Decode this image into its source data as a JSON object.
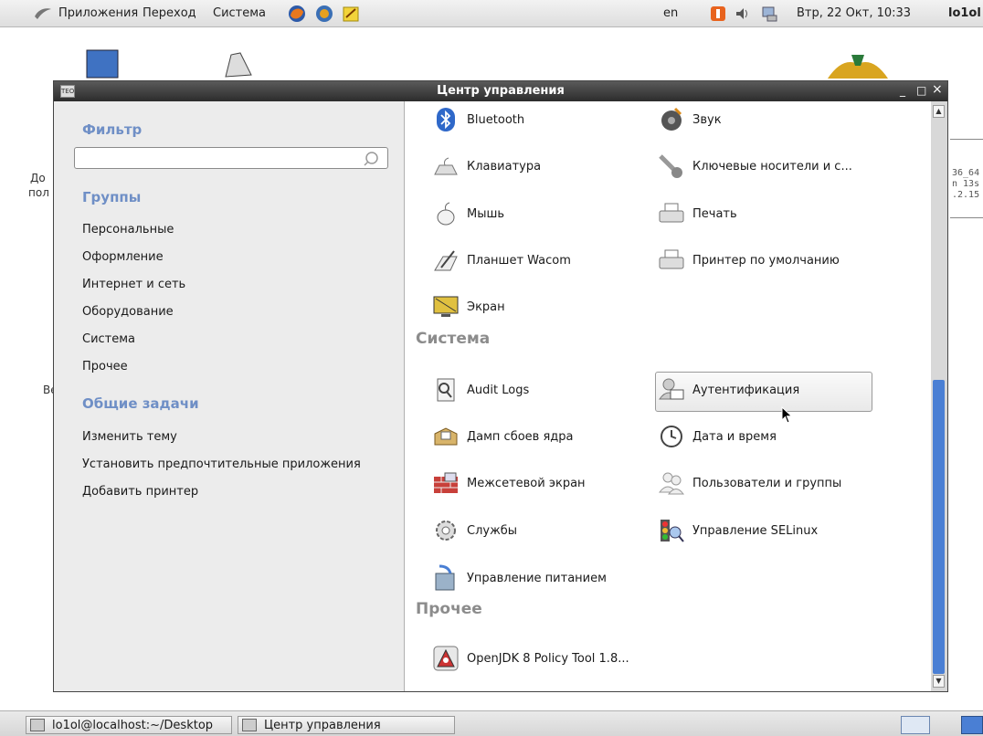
{
  "top_panel": {
    "menu": [
      "Приложения",
      "Переход",
      "Система"
    ],
    "keyboard_layout": "en",
    "clock": "Втр, 22 Окт, 10:33",
    "user": "lo1ol"
  },
  "desktop": {
    "left_fragments": [
      "До",
      "пол",
      "Ве"
    ],
    "right_fragments": [
      "36_64",
      "n 13s",
      ".2.15"
    ]
  },
  "window": {
    "title": "Центр управления",
    "minimize": "_",
    "maximize": "□",
    "close": "×",
    "app_icon_text": "TEO"
  },
  "sidebar": {
    "filter_heading": "Фильтр",
    "filter_value": "",
    "groups_heading": "Группы",
    "groups": [
      "Персональные",
      "Оформление",
      "Интернет и сеть",
      "Оборудование",
      "Система",
      "Прочее"
    ],
    "tasks_heading": "Общие задачи",
    "tasks": [
      "Изменить тему",
      "Установить предпочтительные приложения",
      "Добавить принтер"
    ]
  },
  "content": {
    "hardware_items": [
      {
        "label": "Bluetooth",
        "icon": "bluetooth-icon"
      },
      {
        "label": "Звук",
        "icon": "sound-icon"
      },
      {
        "label": "Клавиатура",
        "icon": "keyboard-icon"
      },
      {
        "label": "Ключевые носители и с...",
        "icon": "key-icon"
      },
      {
        "label": "Мышь",
        "icon": "mouse-icon"
      },
      {
        "label": "Печать",
        "icon": "printer-icon"
      },
      {
        "label": "Планшет Wacom",
        "icon": "tablet-icon"
      },
      {
        "label": "Принтер по умолчанию",
        "icon": "printer-icon"
      },
      {
        "label": "Экран",
        "icon": "display-icon"
      }
    ],
    "system_heading": "Система",
    "system_items": [
      {
        "label": "Audit Logs",
        "icon": "log-icon"
      },
      {
        "label": "Аутентификация",
        "icon": "authentication-icon"
      },
      {
        "label": "Дамп сбоев ядра",
        "icon": "crash-dump-icon"
      },
      {
        "label": "Дата и время",
        "icon": "clock-icon"
      },
      {
        "label": "Межсетевой экран",
        "icon": "firewall-icon"
      },
      {
        "label": "Пользователи и группы",
        "icon": "users-icon"
      },
      {
        "label": "Службы",
        "icon": "services-icon"
      },
      {
        "label": "Управление SELinux",
        "icon": "selinux-icon"
      },
      {
        "label": "Управление питанием",
        "icon": "power-icon"
      }
    ],
    "other_heading": "Прочее",
    "other_items": [
      {
        "label": "OpenJDK 8 Policy Tool 1.8...",
        "icon": "java-icon"
      }
    ],
    "selected_item": "Аутентификация"
  },
  "taskbar": {
    "tasks": [
      "lo1ol@localhost:~/Desktop",
      "Центр управления"
    ]
  },
  "colors": {
    "heading_blue": "#6f8fc6",
    "section_gray": "#8c8c8c",
    "scroll_thumb": "#4a7fd4",
    "titlebar": "#2c2c2c"
  }
}
